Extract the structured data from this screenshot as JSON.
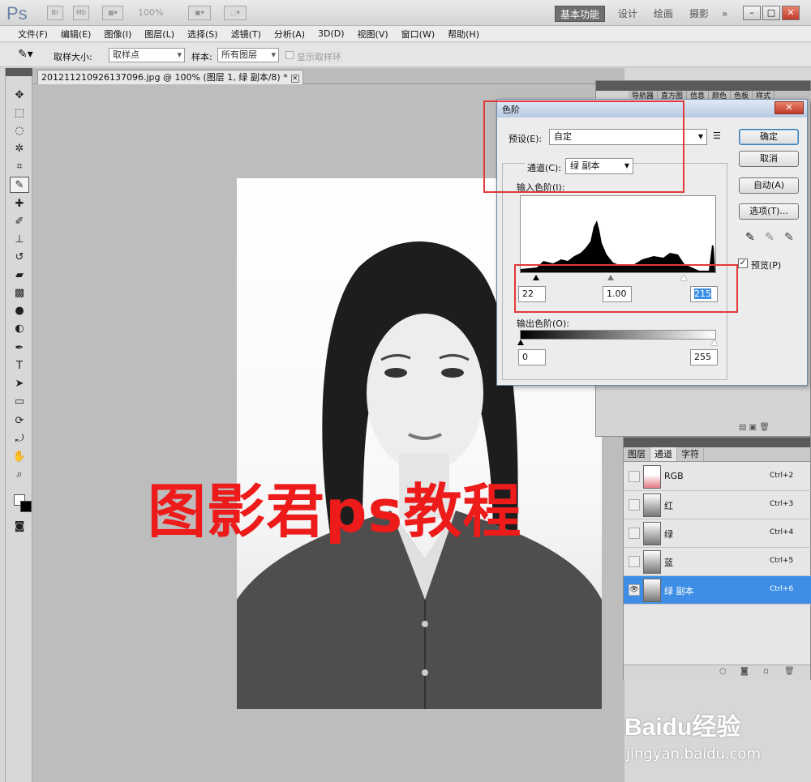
{
  "app": {
    "zoom": "100%",
    "workspaces": [
      "基本功能",
      "设计",
      "绘画",
      "摄影",
      "»"
    ]
  },
  "menu": [
    "文件(F)",
    "编辑(E)",
    "图像(I)",
    "图层(L)",
    "选择(S)",
    "滤镜(T)",
    "分析(A)",
    "3D(D)",
    "视图(V)",
    "窗口(W)",
    "帮助(H)"
  ],
  "options": {
    "sample_size_label": "取样大小:",
    "sample_size_value": "取样点",
    "sample_label": "样本:",
    "sample_value": "所有图层",
    "show_ring_label": "显示取样环"
  },
  "document": {
    "tab_title": "201211210926137096.jpg @ 100% (图层 1, 绿 副本/8) *",
    "watermark_text": "图影君ps教程"
  },
  "top_panel_tabs": [
    "导航器",
    "直方图",
    "信息",
    "颜色",
    "色板",
    "样式"
  ],
  "levels_dialog": {
    "title": "色阶",
    "preset_label": "预设(E):",
    "preset_value": "自定",
    "channel_label": "通道(C):",
    "channel_value": "绿 副本",
    "input_levels_label": "输入色阶(I):",
    "input_black": "22",
    "input_gamma": "1.00",
    "input_white": "215",
    "output_levels_label": "输出色阶(O):",
    "output_black": "0",
    "output_white": "255",
    "buttons": {
      "ok": "确定",
      "cancel": "取消",
      "auto": "自动(A)",
      "options": "选项(T)..."
    },
    "preview_label": "预览(P)",
    "preview_checked": true
  },
  "channels_panel": {
    "tabs": [
      "图层",
      "通道",
      "字符"
    ],
    "active_tab": "通道",
    "rows": [
      {
        "name": "RGB",
        "shortcut": "Ctrl+2"
      },
      {
        "name": "红",
        "shortcut": "Ctrl+3"
      },
      {
        "name": "绿",
        "shortcut": "Ctrl+4"
      },
      {
        "name": "蓝",
        "shortcut": "Ctrl+5"
      },
      {
        "name": "绿 副本",
        "shortcut": "Ctrl+6"
      }
    ]
  },
  "baidu": {
    "logo": "Baidu经验",
    "url": "jingyan.baidu.com"
  }
}
